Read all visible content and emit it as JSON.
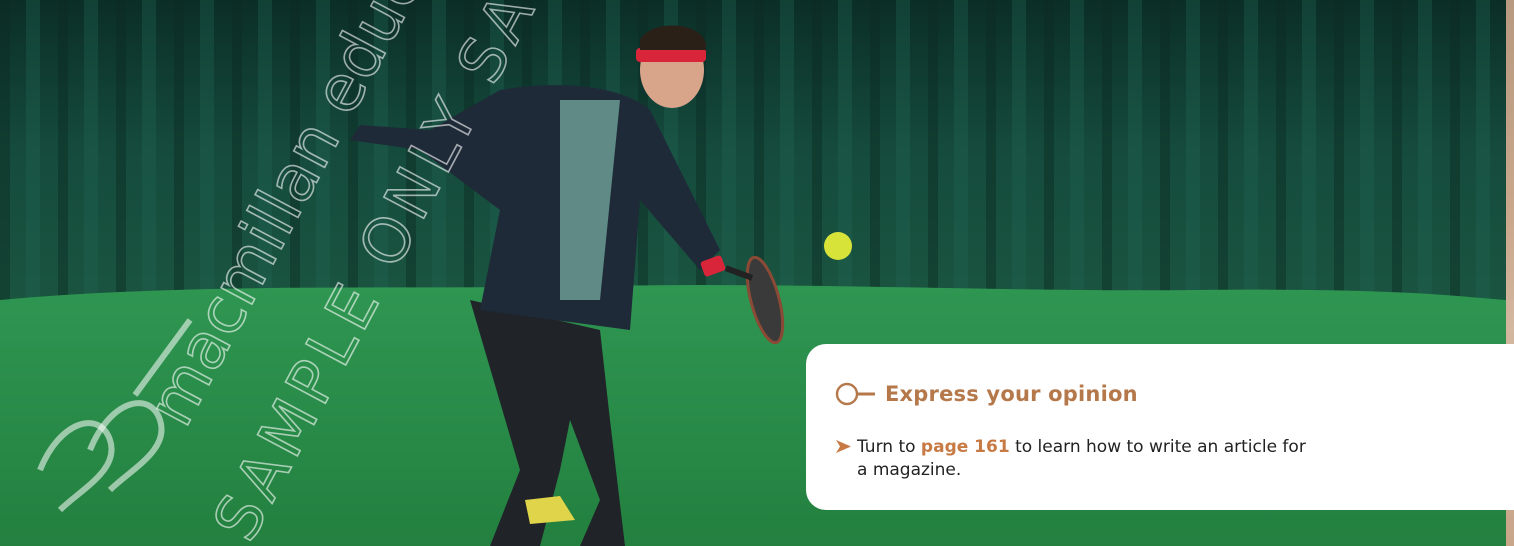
{
  "watermark": {
    "publisher": "macmillan education",
    "sample_note": "SAMPLE ONLY SAMPLE"
  },
  "opinion_box": {
    "title": "Express your opinion",
    "icon": "key-icon",
    "bullet_icon": "arrow-icon",
    "text_before": "Turn to ",
    "page_link": "page 161",
    "text_after_line1": " to learn how to write an article for",
    "text_line2": "a magazine."
  },
  "colors": {
    "accent": "#b5784a",
    "link": "#c87a44",
    "curtain": "#124538",
    "court": "#2a8f4a"
  }
}
